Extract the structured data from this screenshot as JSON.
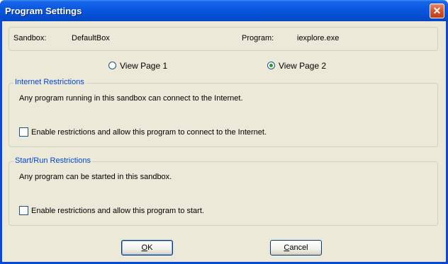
{
  "window": {
    "title": "Program Settings",
    "close_glyph": "✕"
  },
  "info": {
    "sandbox_label": "Sandbox:",
    "sandbox_value": "DefaultBox",
    "program_label": "Program:",
    "program_value": "iexplore.exe"
  },
  "view_pages": [
    {
      "label": "View Page 1",
      "selected": false
    },
    {
      "label": "View Page 2",
      "selected": true
    }
  ],
  "internet_group": {
    "legend": "Internet Restrictions",
    "description": "Any program running in this sandbox can connect to the Internet.",
    "checkbox_label": "Enable restrictions and allow this program to connect to the Internet.",
    "checked": false
  },
  "startrun_group": {
    "legend": "Start/Run Restrictions",
    "description": "Any program can be started in this sandbox.",
    "checkbox_label": "Enable restrictions and allow this program to start.",
    "checked": false
  },
  "buttons": {
    "ok_accel": "O",
    "ok_rest": "K",
    "cancel_accel": "C",
    "cancel_rest": "ancel"
  }
}
